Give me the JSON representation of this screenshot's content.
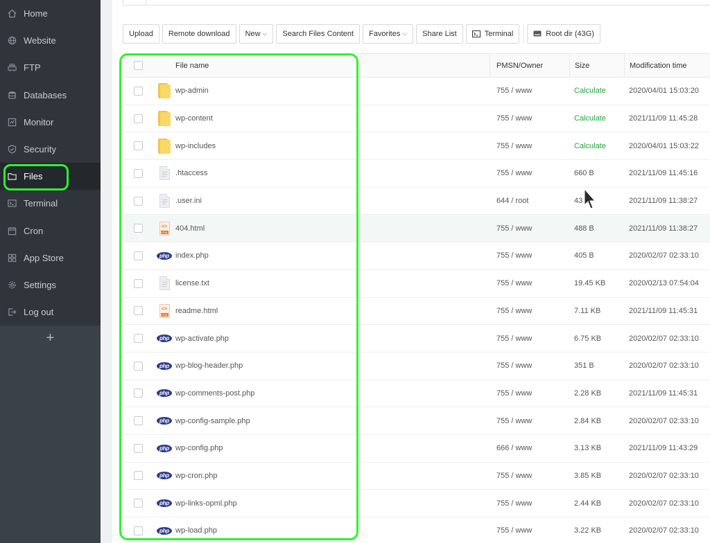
{
  "sidebar": {
    "items": [
      {
        "label": "Home",
        "icon": "home-icon"
      },
      {
        "label": "Website",
        "icon": "globe-icon"
      },
      {
        "label": "FTP",
        "icon": "ftp-icon"
      },
      {
        "label": "Databases",
        "icon": "database-icon"
      },
      {
        "label": "Monitor",
        "icon": "monitor-icon"
      },
      {
        "label": "Security",
        "icon": "shield-icon"
      },
      {
        "label": "Files",
        "icon": "folder-icon",
        "active": true
      },
      {
        "label": "Terminal",
        "icon": "terminal-icon"
      },
      {
        "label": "Cron",
        "icon": "calendar-icon"
      },
      {
        "label": "App Store",
        "icon": "grid-icon"
      },
      {
        "label": "Settings",
        "icon": "gear-icon"
      },
      {
        "label": "Log out",
        "icon": "logout-icon"
      }
    ],
    "add_label": "+"
  },
  "toolbar": {
    "upload": "Upload",
    "remote_download": "Remote download",
    "new": "New",
    "search_files_content": "Search Files Content",
    "favorites": "Favorites",
    "share_list": "Share List",
    "terminal": "Terminal",
    "root_dir": "Root dir (43G)"
  },
  "table": {
    "headers": {
      "name": "File name",
      "perm": "PMSN/Owner",
      "size": "Size",
      "time": "Modification time"
    },
    "rows": [
      {
        "type": "folder",
        "name": "wp-admin",
        "perm": "755 / www",
        "size": "Calculate",
        "time": "2020/04/01 15:03:20"
      },
      {
        "type": "folder",
        "name": "wp-content",
        "perm": "755 / www",
        "size": "Calculate",
        "time": "2021/11/09 11:45:28"
      },
      {
        "type": "folder",
        "name": "wp-includes",
        "perm": "755 / www",
        "size": "Calculate",
        "time": "2020/04/01 15:03:22"
      },
      {
        "type": "doc",
        "name": ".htaccess",
        "perm": "755 / www",
        "size": "660 B",
        "time": "2021/11/09 11:45:16"
      },
      {
        "type": "doc",
        "name": ".user.ini",
        "perm": "644 / root",
        "size": "43 B",
        "time": "2021/11/09 11:38:27"
      },
      {
        "type": "html",
        "name": "404.html",
        "perm": "755 / www",
        "size": "488 B",
        "time": "2021/11/09 11:38:27"
      },
      {
        "type": "php",
        "name": "index.php",
        "perm": "755 / www",
        "size": "405 B",
        "time": "2020/02/07 02:33:10"
      },
      {
        "type": "doc",
        "name": "license.txt",
        "perm": "755 / www",
        "size": "19.45 KB",
        "time": "2020/02/13 07:54:04"
      },
      {
        "type": "html",
        "name": "readme.html",
        "perm": "755 / www",
        "size": "7.11 KB",
        "time": "2021/11/09 11:45:31"
      },
      {
        "type": "php",
        "name": "wp-activate.php",
        "perm": "755 / www",
        "size": "6.75 KB",
        "time": "2020/02/07 02:33:10"
      },
      {
        "type": "php",
        "name": "wp-blog-header.php",
        "perm": "755 / www",
        "size": "351 B",
        "time": "2020/02/07 02:33:10"
      },
      {
        "type": "php",
        "name": "wp-comments-post.php",
        "perm": "755 / www",
        "size": "2.28 KB",
        "time": "2021/11/09 11:45:31"
      },
      {
        "type": "php",
        "name": "wp-config-sample.php",
        "perm": "755 / www",
        "size": "2.84 KB",
        "time": "2020/02/07 02:33:10"
      },
      {
        "type": "php",
        "name": "wp-config.php",
        "perm": "666 / www",
        "size": "3.13 KB",
        "time": "2021/11/09 11:43:29"
      },
      {
        "type": "php",
        "name": "wp-cron.php",
        "perm": "755 / www",
        "size": "3.85 KB",
        "time": "2020/02/07 02:33:10"
      },
      {
        "type": "php",
        "name": "wp-links-opml.php",
        "perm": "755 / www",
        "size": "2.44 KB",
        "time": "2020/02/07 02:33:10"
      },
      {
        "type": "php",
        "name": "wp-load.php",
        "perm": "755 / www",
        "size": "3.22 KB",
        "time": "2020/02/07 02:33:10"
      }
    ]
  },
  "icons": {
    "php_label": "php",
    "html_code": "<>",
    "html_tag": "HTML"
  },
  "colors": {
    "sidebar_bg": "#3b4149",
    "active_bg": "#23282d",
    "calculate": "#20a53a",
    "highlight": "#2ef52e"
  }
}
